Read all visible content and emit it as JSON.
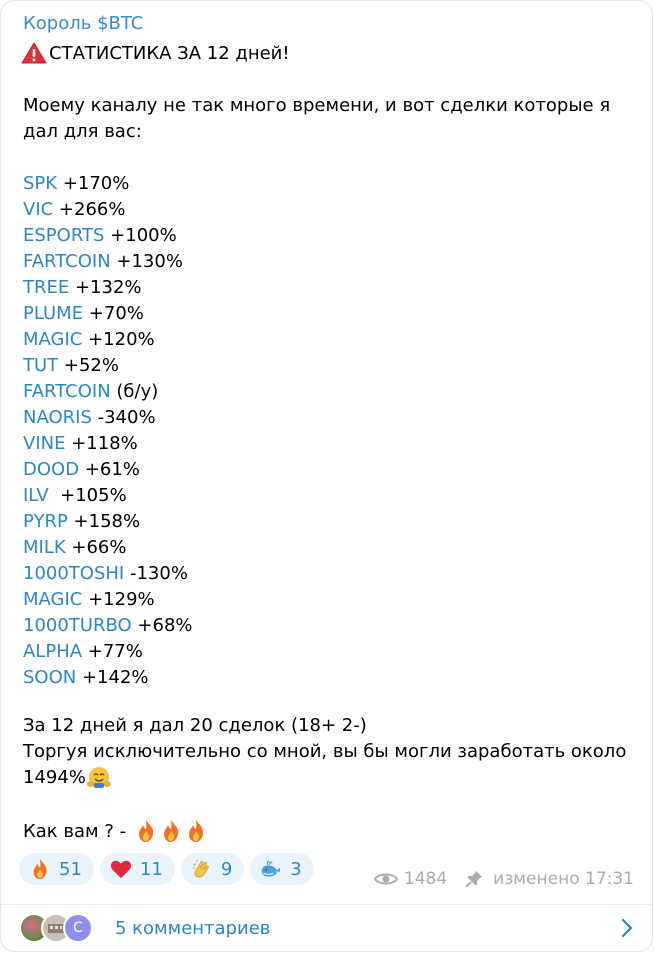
{
  "channel": {
    "name": "Король $BTC"
  },
  "post": {
    "headline": "СТАТИСТИКА ЗА 12 дней!",
    "intro": "Моему каналу не так много времени, и вот сделки которые я дал для вас:",
    "trades": [
      {
        "ticker": "SPK",
        "result": " +170%"
      },
      {
        "ticker": "VIC",
        "result": " +266%"
      },
      {
        "ticker": "ESPORTS",
        "result": " +100%"
      },
      {
        "ticker": "FARTCOIN",
        "result": " +130%"
      },
      {
        "ticker": "TREE",
        "result": " +132%"
      },
      {
        "ticker": "PLUME",
        "result": " +70%"
      },
      {
        "ticker": "MAGIC",
        "result": " +120%"
      },
      {
        "ticker": "TUT",
        "result": " +52%"
      },
      {
        "ticker": "FARTCOIN",
        "result": " (б/у)"
      },
      {
        "ticker": "NAORIS",
        "result": " -340%"
      },
      {
        "ticker": "VINE",
        "result": " +118%"
      },
      {
        "ticker": "DOOD",
        "result": " +61%"
      },
      {
        "ticker": "ILV",
        "result": "  +105%"
      },
      {
        "ticker": "PYRP",
        "result": " +158%"
      },
      {
        "ticker": "MILK",
        "result": " +66%"
      },
      {
        "ticker": "1000TOSHI",
        "result": " -130%"
      },
      {
        "ticker": "MAGIC",
        "result": " +129%"
      },
      {
        "ticker": "1000TURBO",
        "result": " +68%"
      },
      {
        "ticker": "ALPHA",
        "result": " +77%"
      },
      {
        "ticker": "SOON",
        "result": " +142%"
      }
    ],
    "summary_line1": "За 12 дней я дал 20 сделок (18+ 2-)",
    "summary_line2": "Торгуя исключительно со мной, вы бы могли заработать около",
    "summary_line3": "1494%",
    "question": "Как вам ? -"
  },
  "reactions": [
    {
      "emoji": "fire",
      "count": "51"
    },
    {
      "emoji": "heart",
      "count": "11"
    },
    {
      "emoji": "clap",
      "count": "9"
    },
    {
      "emoji": "whale",
      "count": "3"
    }
  ],
  "meta": {
    "views": "1484",
    "edited": "изменено 17:31"
  },
  "comments": {
    "label": "5 комментариев",
    "avatar_letter": "С"
  }
}
